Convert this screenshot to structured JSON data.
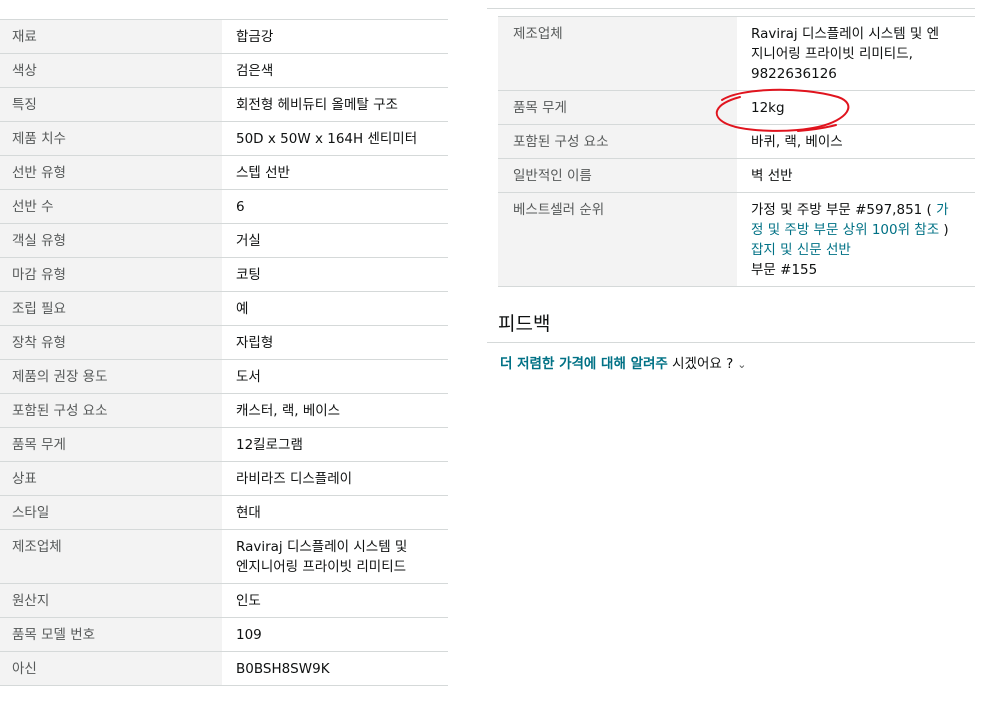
{
  "left_table": {
    "rows": [
      {
        "key": "재료",
        "value": "합금강"
      },
      {
        "key": "색상",
        "value": "검은색"
      },
      {
        "key": "특징",
        "value": "회전형 헤비듀티 올메탈 구조"
      },
      {
        "key": "제품 치수",
        "value": "50D x 50W x 164H 센티미터"
      },
      {
        "key": "선반 유형",
        "value": "스텝 선반"
      },
      {
        "key": "선반 수",
        "value": "6"
      },
      {
        "key": "객실 유형",
        "value": "거실"
      },
      {
        "key": "마감 유형",
        "value": "코팅"
      },
      {
        "key": "조립 필요",
        "value": "예"
      },
      {
        "key": "장착 유형",
        "value": "자립형"
      },
      {
        "key": "제품의 권장 용도",
        "value": "도서"
      },
      {
        "key": "포함된 구성 요소",
        "value": "캐스터, 랙, 베이스"
      },
      {
        "key": "품목 무게",
        "value": "12킬로그램"
      },
      {
        "key": "상표",
        "value": "라비라즈 디스플레이"
      },
      {
        "key": "스타일",
        "value": "현대"
      },
      {
        "key": "제조업체",
        "value": "Raviraj 디스플레이 시스템 및",
        "value2": "엔지니어링 프라이빗 리미티드"
      },
      {
        "key": "원산지",
        "value": "인도"
      },
      {
        "key": "품목 모델 번호",
        "value": "109"
      },
      {
        "key": "아신",
        "value": "B0BSH8SW9K"
      }
    ]
  },
  "right_table": {
    "manufacturer": {
      "key": "제조업체",
      "line1": "Raviraj 디스플레이 시스템 및 엔",
      "line2": "지니어링 프라이빗 리미티드,",
      "line3": "9822636126"
    },
    "weight": {
      "key": "품목 무게",
      "value": "12kg"
    },
    "components": {
      "key": "포함된 구성 요소",
      "value": "바퀴, 랙, 베이스"
    },
    "generic_name": {
      "key": "일반적인 이름",
      "value": "벽 선반"
    },
    "bestseller": {
      "key": "베스트셀러 순위",
      "line1_text": "가정 및 주방 부문 #597,851 ( ",
      "line1_link": "가",
      "line2_link": "정 및 주방 부문 상위 100위 참조",
      "line2_text": " )",
      "line3_link": "잡지 및 신문 선반",
      "line4_text": "부문 #155"
    }
  },
  "feedback": {
    "title": "피드백",
    "link_text": "더 저렴한 가격에 대해 알려주",
    "link_suffix": " 시겠어요 ?",
    "chevron": "⌄"
  },
  "annotation": {
    "color": "#e0141e"
  }
}
